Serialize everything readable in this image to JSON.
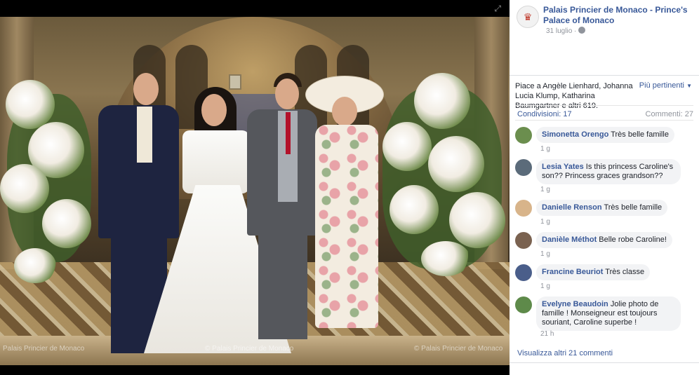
{
  "photo": {
    "watermark_left": "Palais Princier de Monaco",
    "watermark_center": "© Palais Princier de Monaco",
    "watermark_right": "© Palais Princier de Monaco",
    "expand_icon": "expand-icon"
  },
  "post": {
    "page_name": "Palais Princier de Monaco - Prince's Palace of Monaco",
    "date": "31 luglio",
    "privacy_icon": "globe-icon"
  },
  "reactions": {
    "likes_text": "Piace a Angèle Lienhard, Johanna Lucia Klump, Katharina Baumgartner e altri 619.",
    "relevance_label": "Più pertinenti",
    "shares": "Condivisioni: 17",
    "comments": "Commenti: 27"
  },
  "comments": [
    {
      "name": "Simonetta Orengo",
      "text": "Très belle famille",
      "time": "1 g",
      "avatar_color": "#6b8e4e"
    },
    {
      "name": "Lesia Yates",
      "text": "Is this princess Caroline's son?? Princess graces grandson??",
      "time": "1 g",
      "avatar_color": "#5b6b7a"
    },
    {
      "name": "Danielle Renson",
      "text": "Très belle famille",
      "time": "1 g",
      "avatar_color": "#d8b48a"
    },
    {
      "name": "Danièle Méthot",
      "text": "Belle robe Caroline!",
      "time": "1 g",
      "avatar_color": "#7a6250"
    },
    {
      "name": "Francine Beuriot",
      "text": "Très classe",
      "time": "1 g",
      "avatar_color": "#4a5e8a"
    },
    {
      "name": "Evelyne Beaudoin",
      "text": "Jolie photo de famille ! Monseigneur est toujours souriant, Caroline superbe !",
      "time": "21 h",
      "avatar_color": "#5e8a4a"
    }
  ],
  "more_comments": "Visualizza altri 21 commenti"
}
